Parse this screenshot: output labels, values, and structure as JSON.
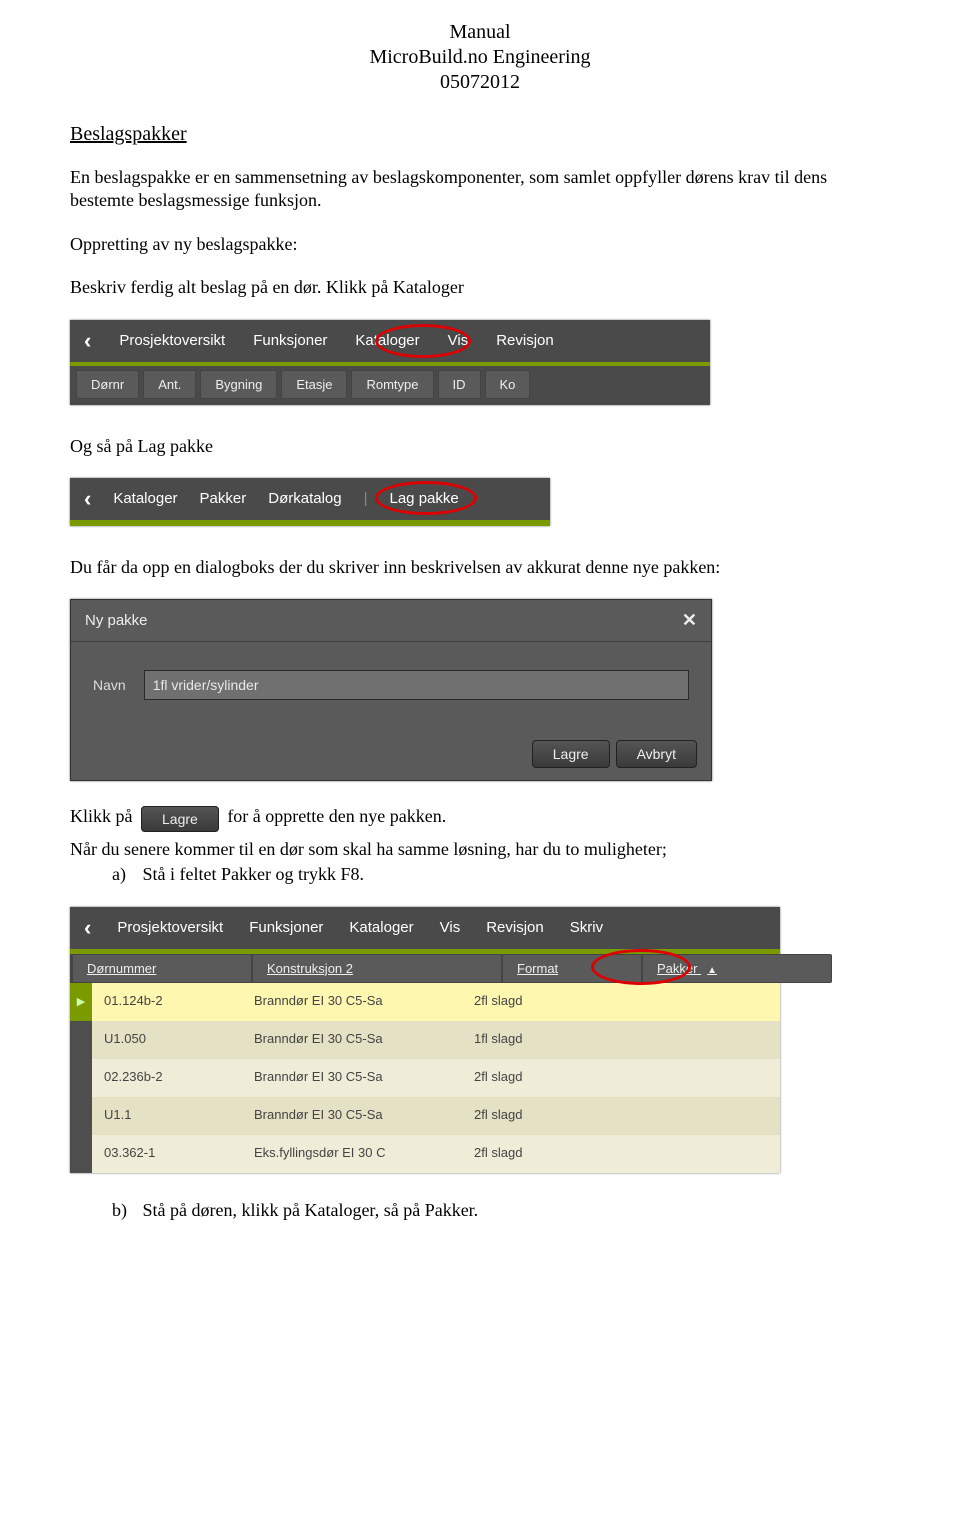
{
  "header": {
    "line1": "Manual",
    "line2": "MicroBuild.no Engineering",
    "line3": "05072012"
  },
  "section_title": "Beslagspakker",
  "paragraphs": {
    "intro": "En beslagspakke er en sammensetning av beslagskomponenter, som samlet oppfyller dørens krav til dens bestemte beslagsmessige funksjon.",
    "oppretting": "Oppretting av ny beslagspakke:",
    "beskriv": "Beskriv ferdig alt beslag på en dør. Klikk på Kataloger",
    "lag_pakke": "Og så på Lag pakke",
    "dialog_intro": "Du får da opp en dialogboks der du skriver inn beskrivelsen av akkurat denne nye pakken:",
    "klikk_prefix": "Klikk på",
    "klikk_suffix": " for å opprette den nye pakken.",
    "senere": "Når du senere kommer til en dør som skal ha samme løsning, har du to muligheter;",
    "opt_a": "Stå i feltet Pakker og trykk F8.",
    "opt_b": "Stå på døren, klikk på Kataloger, så på Pakker."
  },
  "list_letters": {
    "a": "a)",
    "b": "b)"
  },
  "screenshot1": {
    "menu": {
      "proj": "Prosjektoversikt",
      "funk": "Funksjoner",
      "kat": "Kataloger",
      "vis": "Vis",
      "rev": "Revisjon"
    },
    "cols": {
      "dornr": "Dørnr",
      "ant": "Ant.",
      "bygning": "Bygning",
      "etasje": "Etasje",
      "romtype": "Romtype",
      "id": "ID",
      "ko": "Ko"
    }
  },
  "screenshot2": {
    "menu": {
      "kat": "Kataloger",
      "pakker": "Pakker",
      "dork": "Dørkatalog",
      "lag": "Lag pakke"
    }
  },
  "dialog": {
    "title": "Ny pakke",
    "label": "Navn",
    "value": "1fl vrider/sylinder",
    "save": "Lagre",
    "cancel": "Avbryt"
  },
  "inline_lagre": "Lagre",
  "screenshot4": {
    "menu": {
      "proj": "Prosjektoversikt",
      "funk": "Funksjoner",
      "kat": "Kataloger",
      "vis": "Vis",
      "rev": "Revisjon",
      "skriv": "Skriv"
    },
    "cols": {
      "dornummer": "Dørnummer",
      "konstr": "Konstruksjon 2",
      "format": "Format",
      "pakker": "Pakker"
    },
    "sort_arrow": "▲",
    "rows": [
      {
        "c0": "01.124b-2",
        "c1": "Branndør EI 30 C5-Sa",
        "c2": "2fl slagd",
        "c3": ""
      },
      {
        "c0": "U1.050",
        "c1": "Branndør EI 30 C5-Sa",
        "c2": "1fl slagd",
        "c3": ""
      },
      {
        "c0": "02.236b-2",
        "c1": "Branndør EI 30 C5-Sa",
        "c2": "2fl slagd",
        "c3": ""
      },
      {
        "c0": "U1.1",
        "c1": "Branndør EI 30 C5-Sa",
        "c2": "2fl slagd",
        "c3": ""
      },
      {
        "c0": "03.362-1",
        "c1": "Eks.fyllingsdør EI 30 C",
        "c2": "2fl slagd",
        "c3": ""
      }
    ]
  }
}
